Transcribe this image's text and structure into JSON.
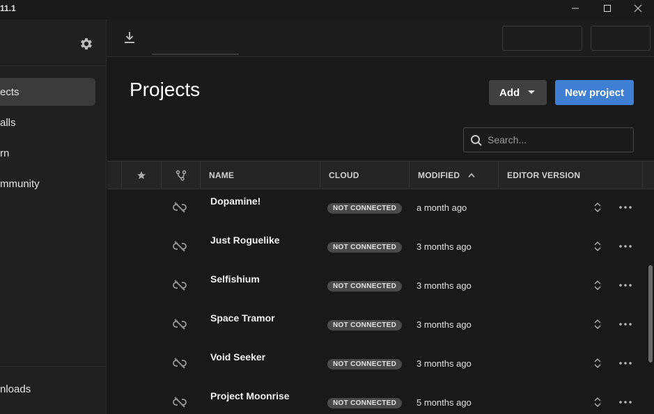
{
  "window": {
    "title": "11.1"
  },
  "sidebar": {
    "items": [
      {
        "label": "ects",
        "active": true
      },
      {
        "label": "alls",
        "active": false
      },
      {
        "label": "rn",
        "active": false
      },
      {
        "label": "mmunity",
        "active": false
      }
    ],
    "footer_label": "nloads",
    "settings_icon": "gear-icon"
  },
  "header": {
    "download_icon": "download-icon"
  },
  "main": {
    "title": "Projects",
    "add_label": "Add",
    "new_project_label": "New project",
    "search": {
      "placeholder": "Search...",
      "value": ""
    }
  },
  "table": {
    "columns": {
      "star_icon": "star-icon",
      "link_icon": "branch-icon",
      "name": "NAME",
      "cloud": "CLOUD",
      "modified": "MODIFIED",
      "editor_version": "EDITOR VERSION"
    },
    "rows": [
      {
        "name": "Dopamine!",
        "cloud": "NOT CONNECTED",
        "modified": "a month ago"
      },
      {
        "name": "Just Roguelike",
        "cloud": "NOT CONNECTED",
        "modified": "3 months ago"
      },
      {
        "name": "Selfishium",
        "cloud": "NOT CONNECTED",
        "modified": "3 months ago"
      },
      {
        "name": "Space Tramor",
        "cloud": "NOT CONNECTED",
        "modified": "3 months ago"
      },
      {
        "name": "Void Seeker",
        "cloud": "NOT CONNECTED",
        "modified": "3 months ago"
      },
      {
        "name": "Project Moonrise",
        "cloud": "NOT CONNECTED",
        "modified": "5 months ago"
      }
    ]
  },
  "colors": {
    "accent": "#3f7fd4",
    "background": "#191919",
    "sidebar": "#202020",
    "badge": "#4a4a4a"
  }
}
